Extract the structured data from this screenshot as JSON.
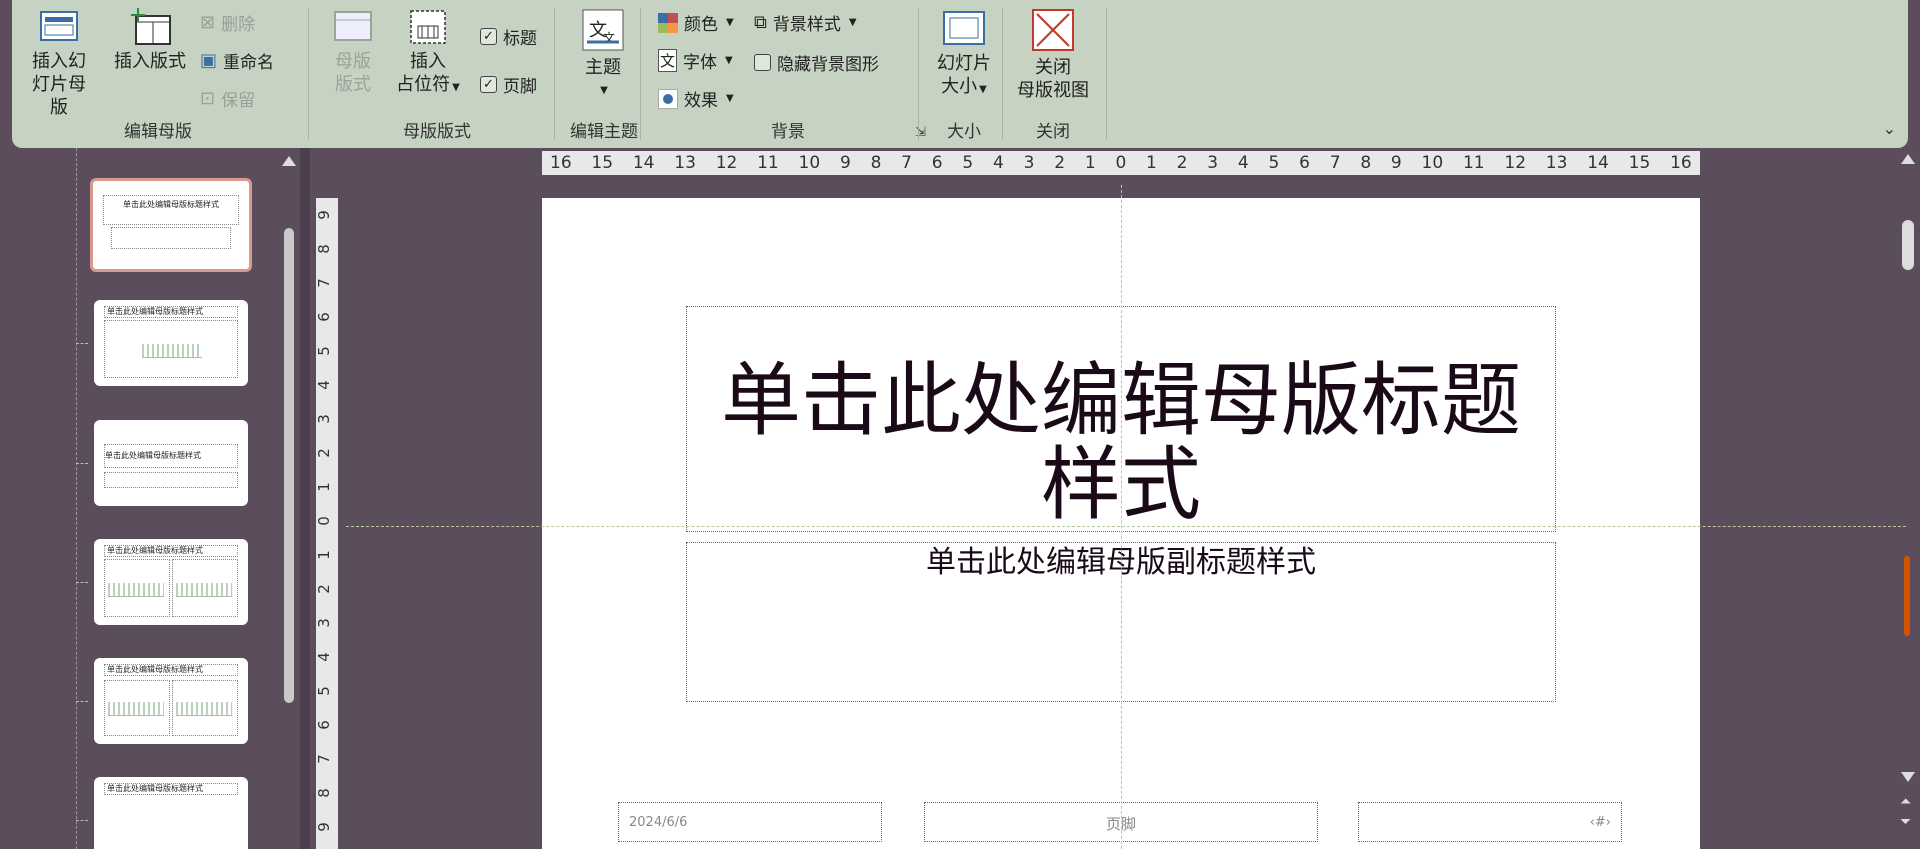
{
  "ribbon": {
    "groups": {
      "edit_master": {
        "label": "编辑母版",
        "insert_slide_master": [
          "插入幻",
          "灯片母版"
        ],
        "insert_layout": "插入版式",
        "delete": "删除",
        "rename": "重命名",
        "preserve": "保留"
      },
      "master_layout": {
        "label": "母版版式",
        "master_layout_btn": [
          "母版",
          "版式"
        ],
        "insert_placeholder": [
          "插入",
          "占位符"
        ],
        "title_checkbox": "标题",
        "footer_checkbox": "页脚"
      },
      "edit_theme": {
        "label": "编辑主题",
        "themes": "主题"
      },
      "background": {
        "label": "背景",
        "colors": "颜色",
        "fonts": "字体",
        "effects": "效果",
        "background_styles": "背景样式",
        "hide_background_graphics": "隐藏背景图形"
      },
      "size": {
        "label": "大小",
        "slide_size": [
          "幻灯片",
          "大小"
        ]
      },
      "close": {
        "label": "关闭",
        "close_master_view": [
          "关闭",
          "母版视图"
        ]
      }
    },
    "checkbox_states": {
      "title": true,
      "footer": true,
      "hide_background_graphics": false
    }
  },
  "ruler": {
    "horizontal_ticks": [
      "16",
      "15",
      "14",
      "13",
      "12",
      "11",
      "10",
      "9",
      "8",
      "7",
      "6",
      "5",
      "4",
      "3",
      "2",
      "1",
      "0",
      "1",
      "2",
      "3",
      "4",
      "5",
      "6",
      "7",
      "8",
      "9",
      "10",
      "11",
      "12",
      "13",
      "14",
      "15",
      "16"
    ],
    "vertical_ticks": [
      "9",
      "8",
      "7",
      "6",
      "5",
      "4",
      "3",
      "2",
      "1",
      "0",
      "1",
      "2",
      "3",
      "4",
      "5",
      "6",
      "7",
      "8",
      "9"
    ]
  },
  "thumbnails": [
    {
      "title": "单击此处编辑母版标题样式"
    },
    {
      "title": "单击此处编辑母版标题样式"
    },
    {
      "title": "单击此处编辑母版标题样式"
    },
    {
      "title": "单击此处编辑母版标题样式"
    },
    {
      "title": "单击此处编辑母版标题样式"
    },
    {
      "title": "单击此处编辑母版标题样式"
    }
  ],
  "slide": {
    "title": "单击此处编辑母版标题样式",
    "subtitle": "单击此处编辑母版副标题样式",
    "date": "2024/6/6",
    "footer": "页脚",
    "page_number": "‹#›"
  },
  "colors": {
    "ribbon_bg": "#c6d2c2",
    "workspace_bg": "#5b4d5b",
    "selected_thumb_border": "#d89a8e",
    "close_icon": "#c0392b"
  }
}
